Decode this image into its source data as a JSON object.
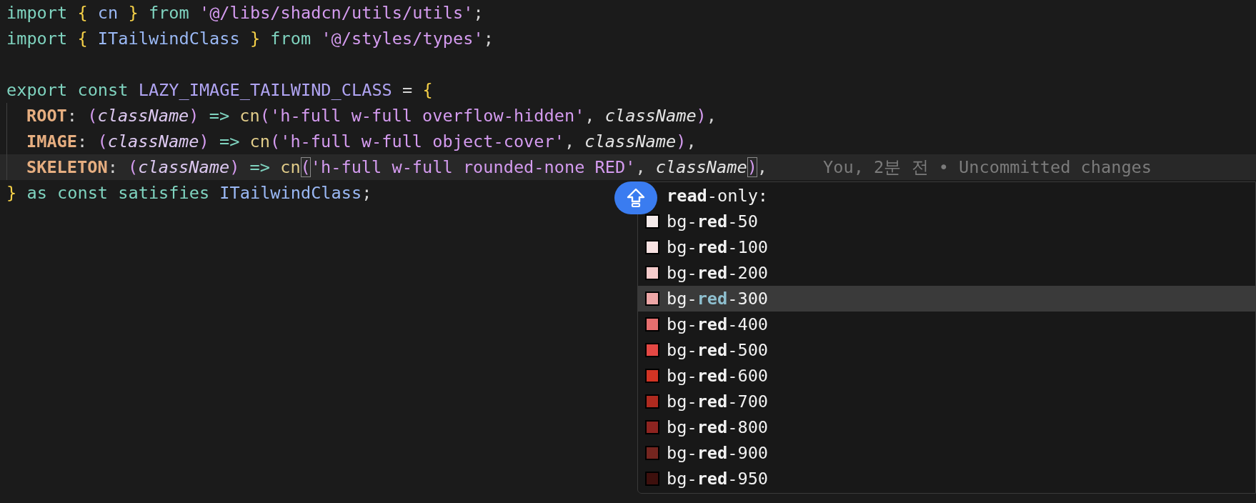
{
  "editor": {
    "lines": [
      {
        "indented": false,
        "highlighted": false,
        "tokens": [
          {
            "text": "import ",
            "kind": "keyword"
          },
          {
            "text": "{",
            "kind": "brace"
          },
          {
            "text": " cn ",
            "kind": "type"
          },
          {
            "text": "}",
            "kind": "brace"
          },
          {
            "text": " from ",
            "kind": "keyword"
          },
          {
            "text": "'@/libs/shadcn/utils/utils'",
            "kind": "string"
          },
          {
            "text": ";",
            "kind": "punct"
          }
        ]
      },
      {
        "indented": false,
        "highlighted": false,
        "tokens": [
          {
            "text": "import ",
            "kind": "keyword"
          },
          {
            "text": "{",
            "kind": "brace"
          },
          {
            "text": " ITailwindClass ",
            "kind": "type"
          },
          {
            "text": "}",
            "kind": "brace"
          },
          {
            "text": " from ",
            "kind": "keyword"
          },
          {
            "text": "'@/styles/types'",
            "kind": "string"
          },
          {
            "text": ";",
            "kind": "punct"
          }
        ]
      },
      {
        "indented": false,
        "highlighted": false
      },
      {
        "indented": false,
        "highlighted": false,
        "tokens": [
          {
            "text": "export const ",
            "kind": "keyword"
          },
          {
            "text": "LAZY_IMAGE_TAILWIND_CLASS",
            "kind": "constant"
          },
          {
            "text": " = ",
            "kind": "punct"
          },
          {
            "text": "{",
            "kind": "brace"
          }
        ]
      },
      {
        "indented": true,
        "highlighted": false,
        "tokens": [
          {
            "text": "ROOT",
            "kind": "property"
          },
          {
            "text": ": ",
            "kind": "punct"
          },
          {
            "text": "(",
            "kind": "paren"
          },
          {
            "text": "className",
            "kind": "param"
          },
          {
            "text": ")",
            "kind": "paren"
          },
          {
            "text": " => ",
            "kind": "keyword"
          },
          {
            "text": "cn",
            "kind": "func"
          },
          {
            "text": "(",
            "kind": "paren"
          },
          {
            "text": "'h-full w-full overflow-hidden'",
            "kind": "string"
          },
          {
            "text": ", ",
            "kind": "punct"
          },
          {
            "text": "className",
            "kind": "arg"
          },
          {
            "text": ")",
            "kind": "paren"
          },
          {
            "text": ",",
            "kind": "punct"
          }
        ]
      },
      {
        "indented": true,
        "highlighted": false,
        "tokens": [
          {
            "text": "IMAGE",
            "kind": "property"
          },
          {
            "text": ": ",
            "kind": "punct"
          },
          {
            "text": "(",
            "kind": "paren"
          },
          {
            "text": "className",
            "kind": "param"
          },
          {
            "text": ")",
            "kind": "paren"
          },
          {
            "text": " => ",
            "kind": "keyword"
          },
          {
            "text": "cn",
            "kind": "func"
          },
          {
            "text": "(",
            "kind": "paren"
          },
          {
            "text": "'h-full w-full object-cover'",
            "kind": "string"
          },
          {
            "text": ", ",
            "kind": "punct"
          },
          {
            "text": "className",
            "kind": "arg"
          },
          {
            "text": ")",
            "kind": "paren"
          },
          {
            "text": ",",
            "kind": "punct"
          }
        ]
      },
      {
        "indented": true,
        "highlighted": true,
        "blame": "You, 2분 전 • Uncommitted changes",
        "tokens": [
          {
            "text": "SKELETON",
            "kind": "property"
          },
          {
            "text": ": ",
            "kind": "punct"
          },
          {
            "text": "(",
            "kind": "paren"
          },
          {
            "text": "className",
            "kind": "param"
          },
          {
            "text": ")",
            "kind": "paren"
          },
          {
            "text": " => ",
            "kind": "keyword"
          },
          {
            "text": "cn",
            "kind": "func"
          },
          {
            "text": "(",
            "kind": "bracket"
          },
          {
            "text": "'h-full w-full rounded-none RED'",
            "kind": "string"
          },
          {
            "text": ", ",
            "kind": "punct"
          },
          {
            "text": "className",
            "kind": "arg"
          },
          {
            "text": ")",
            "kind": "bracket"
          },
          {
            "text": ",",
            "kind": "punct"
          }
        ]
      },
      {
        "indented": false,
        "highlighted": false,
        "tokens": [
          {
            "text": "}",
            "kind": "brace"
          },
          {
            "text": " as const satisfies ",
            "kind": "keyword"
          },
          {
            "text": "ITailwindClass",
            "kind": "type"
          },
          {
            "text": ";",
            "kind": "punct"
          }
        ]
      }
    ]
  },
  "suggestions": [
    {
      "label": "**read**-only:",
      "selected": false
    },
    {
      "label": "bg-**red**-50",
      "color": "#f3e9e9",
      "selected": false
    },
    {
      "label": "bg-**red**-100",
      "color": "#f7e1e1",
      "selected": false
    },
    {
      "label": "bg-**red**-200",
      "color": "#f4cbcb",
      "selected": false
    },
    {
      "label": "bg-**red**-300",
      "color": "#eda6a6",
      "selected": true
    },
    {
      "label": "bg-**red**-400",
      "color": "#e66f6f",
      "selected": false
    },
    {
      "label": "bg-**red**-500",
      "color": "#e44844",
      "selected": false
    },
    {
      "label": "bg-**red**-600",
      "color": "#d23424",
      "selected": false
    },
    {
      "label": "bg-**red**-700",
      "color": "#ae2a1f",
      "selected": false
    },
    {
      "label": "bg-**red**-800",
      "color": "#8e2420",
      "selected": false
    },
    {
      "label": "bg-**red**-900",
      "color": "#74251f",
      "selected": false
    },
    {
      "label": "bg-**red**-950",
      "color": "#3e100d",
      "selected": false
    }
  ]
}
